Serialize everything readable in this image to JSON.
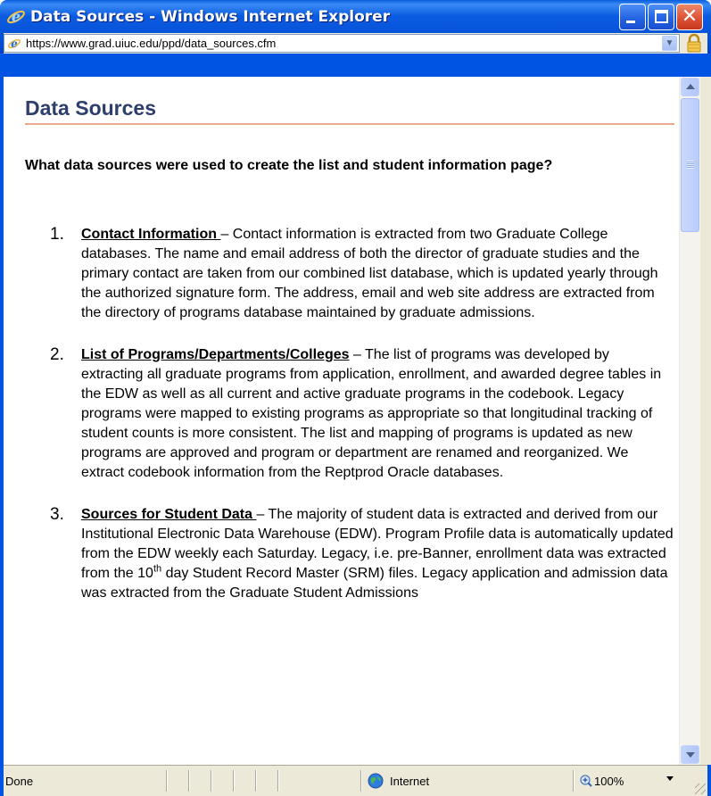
{
  "window": {
    "title": "Data Sources - Windows Internet Explorer",
    "minimize_label": "",
    "maximize_label": "",
    "close_label": "✕"
  },
  "address": {
    "url": "https://www.grad.uiuc.edu/ppd/data_sources.cfm",
    "dropdown_glyph": "▼"
  },
  "page": {
    "title": "Data Sources",
    "question": "What data sources were used to create the list and student information page?",
    "items": [
      {
        "number": "1.",
        "heading": "Contact Information ",
        "text": "– Contact information is extracted from two Graduate College databases.  The name and email address of both the director of graduate studies and the primary contact are taken from our combined list database, which is updated yearly through the authorized signature form. The address, email and web site address are extracted from the directory of programs database maintained by graduate admissions."
      },
      {
        "number": "2.",
        "heading": "List of Programs/Departments/Colleges",
        "text": " – The list of programs was developed by extracting all graduate programs from application, enrollment, and awarded degree tables in the EDW as well as all current and active graduate programs in the codebook.  Legacy programs were mapped to existing programs as appropriate so that longitudinal tracking of student counts is more consistent.  The list and mapping of programs is updated as new programs are approved and program or department are renamed and reorganized.  We extract codebook information from the Reptprod Oracle databases."
      },
      {
        "number": "3.",
        "heading": "Sources for Student Data ",
        "text_before_sup": "– The majority of student data is extracted and derived from our Institutional Electronic Data Warehouse (EDW).  Program Profile data is automatically updated from the EDW weekly each Saturday.  Legacy, i.e. pre-Banner, enrollment data was extracted from the 10",
        "sup": "th",
        "text_after_sup": " day Student Record Master (SRM) files.  Legacy application and admission data was extracted from the Graduate Student Admissions"
      }
    ]
  },
  "statusbar": {
    "status": "Done",
    "zone": "Internet",
    "zoom": "100%"
  },
  "icons": {
    "title_icon": "ie-icon",
    "address_icon": "ie-page-icon",
    "lock": "lock-icon",
    "zone": "globe-icon",
    "zoom": "zoom-icon"
  }
}
